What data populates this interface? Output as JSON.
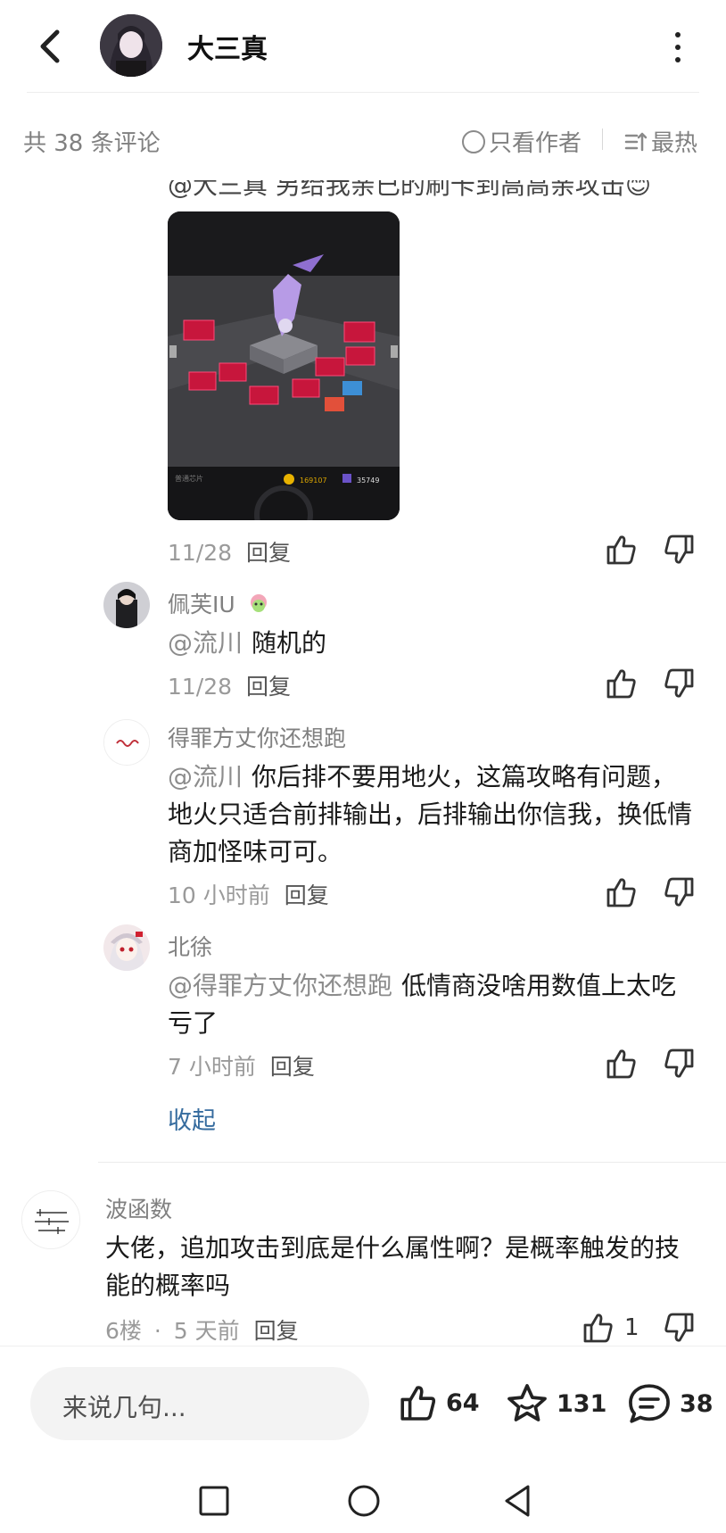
{
  "header": {
    "title": "大三真"
  },
  "filter_bar": {
    "count_label": "共 38 条评论",
    "author_only_label": "只看作者",
    "sort_label": "最热"
  },
  "partial_comment": {
    "text": "@大三真 另给我亲已的刷卡到高高亲攻击😊"
  },
  "screenshot_comment": {
    "date": "11/28",
    "reply_label": "回复"
  },
  "comments": [
    {
      "nick": "佩芙IU",
      "at": "@流川",
      "text": "随机的",
      "date": "11/28",
      "reply_label": "回复"
    },
    {
      "nick": "得罪方丈你还想跑",
      "at": "@流川",
      "text": "你后排不要用地火，这篇攻略有问题，地火只适合前排输出，后排输出你信我，换低情商加怪味可可。",
      "date": "10 小时前",
      "reply_label": "回复"
    },
    {
      "nick": "北徐",
      "at": "@得罪方丈你还想跑",
      "text": "低情商没啥用数值上太吃亏了",
      "date": "7 小时前",
      "reply_label": "回复"
    }
  ],
  "collapse_label": "收起",
  "top_comment": {
    "nick": "波函数",
    "text": "大佬，追加攻击到底是什么属性啊？是概率触发的技能的概率吗",
    "floor": "6楼",
    "dot": "·",
    "date": "5 天前",
    "reply_label": "回复",
    "likes": "1"
  },
  "bottom": {
    "input_placeholder": "来说几句...",
    "likes": "64",
    "favorites": "131",
    "comments": "38"
  },
  "game_screenshot": {
    "label_left": "普通芯片",
    "coins": "169107",
    "gems": "35749"
  }
}
